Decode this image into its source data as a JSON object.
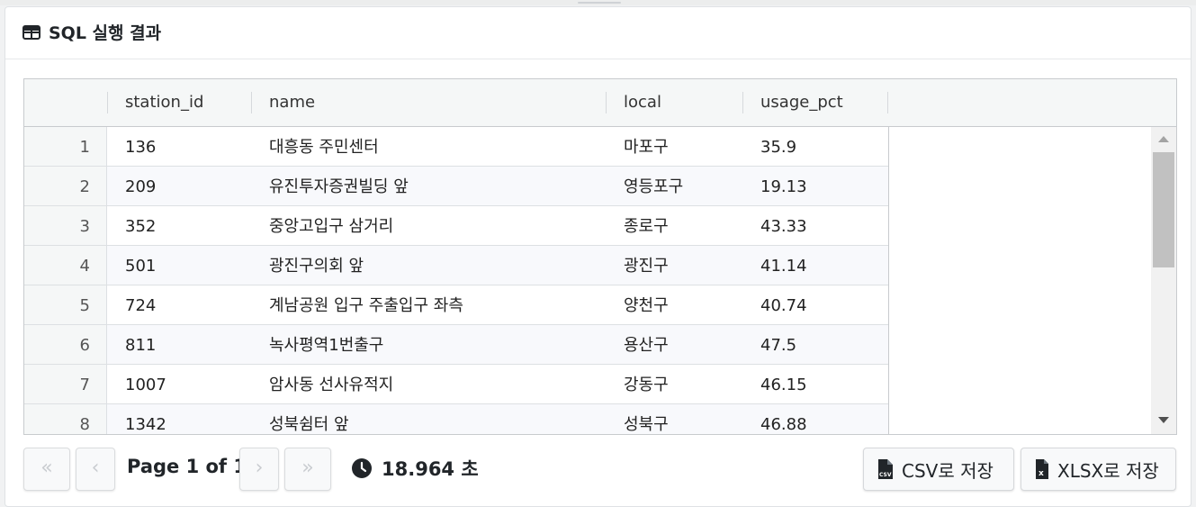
{
  "panel": {
    "title": "SQL 실행 결과"
  },
  "table": {
    "columns": [
      "station_id",
      "name",
      "local",
      "usage_pct"
    ],
    "rows": [
      {
        "num": "1",
        "station_id": "136",
        "name": "대흥동 주민센터",
        "local": "마포구",
        "usage_pct": "35.9"
      },
      {
        "num": "2",
        "station_id": "209",
        "name": "유진투자증권빌딩 앞",
        "local": "영등포구",
        "usage_pct": "19.13"
      },
      {
        "num": "3",
        "station_id": "352",
        "name": "중앙고입구 삼거리",
        "local": "종로구",
        "usage_pct": "43.33"
      },
      {
        "num": "4",
        "station_id": "501",
        "name": "광진구의회 앞",
        "local": "광진구",
        "usage_pct": "41.14"
      },
      {
        "num": "5",
        "station_id": "724",
        "name": "계남공원 입구 주출입구 좌측",
        "local": "양천구",
        "usage_pct": "40.74"
      },
      {
        "num": "6",
        "station_id": "811",
        "name": "녹사평역1번출구",
        "local": "용산구",
        "usage_pct": "47.5"
      },
      {
        "num": "7",
        "station_id": "1007",
        "name": "암사동 선사유적지",
        "local": "강동구",
        "usage_pct": "46.15"
      },
      {
        "num": "8",
        "station_id": "1342",
        "name": "성북쉼터 앞",
        "local": "성북구",
        "usage_pct": "46.88"
      }
    ]
  },
  "pagination": {
    "first_icon": "«",
    "prev_icon": "‹",
    "next_icon": "›",
    "last_icon": "»",
    "page_text": "Page 1 of 1"
  },
  "exec_time": {
    "icon": "clock-icon",
    "text": "18.964 초"
  },
  "export": {
    "csv_label": "CSV로 저장",
    "xlsx_label": "XLSX로 저장"
  }
}
